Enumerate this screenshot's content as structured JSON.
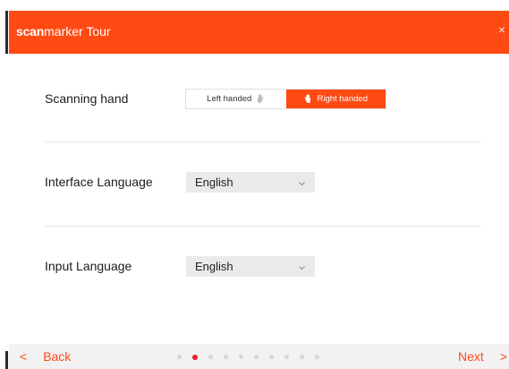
{
  "window": {
    "title_brand_bold": "scan",
    "title_brand_light": "marker",
    "title_suffix": " Tour",
    "close_glyph": "×"
  },
  "settings": {
    "scanning_hand": {
      "label": "Scanning hand",
      "options": [
        "Left handed",
        "Right handed"
      ],
      "selected": "Right handed"
    },
    "interface_language": {
      "label": "Interface Language",
      "value": "English"
    },
    "input_language": {
      "label": "Input Language",
      "value": "English"
    }
  },
  "footer": {
    "back_label": "Back",
    "next_label": "Next",
    "back_glyph": "<",
    "next_glyph": ">",
    "page_count": 10,
    "current_page": 2
  },
  "colors": {
    "accent": "#ff4a14",
    "active_dot": "#e8231f",
    "inactive_dot": "#d6d6d6",
    "select_bg": "#eaeaea",
    "footer_bg": "#f2f2f2"
  },
  "icons": [
    "hand-icon",
    "chevron-down-icon",
    "close-icon",
    "chevron-left-icon",
    "chevron-right-icon"
  ]
}
